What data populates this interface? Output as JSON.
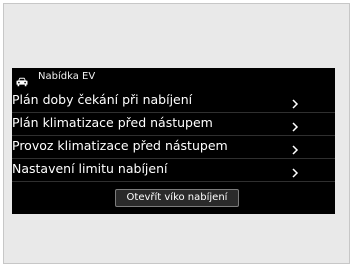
{
  "header": {
    "title": "Nabídka EV",
    "icon": "car-icon"
  },
  "menu": {
    "items": [
      {
        "label": "Plán doby čekání při nabíjení",
        "icon": "chevron-right-icon"
      },
      {
        "label": "Plán klimatizace před nástupem",
        "icon": "chevron-right-icon"
      },
      {
        "label": "Provoz klimatizace před nástupem",
        "icon": "chevron-right-icon"
      },
      {
        "label": "Nastavení limitu nabíjení",
        "icon": "chevron-right-icon"
      }
    ]
  },
  "actions": {
    "open_lid_label": "Otevřít víko nabíjení"
  },
  "colors": {
    "screen_background": "#000000",
    "frame_background": "#e9e9e9",
    "text": "#ffffff"
  }
}
